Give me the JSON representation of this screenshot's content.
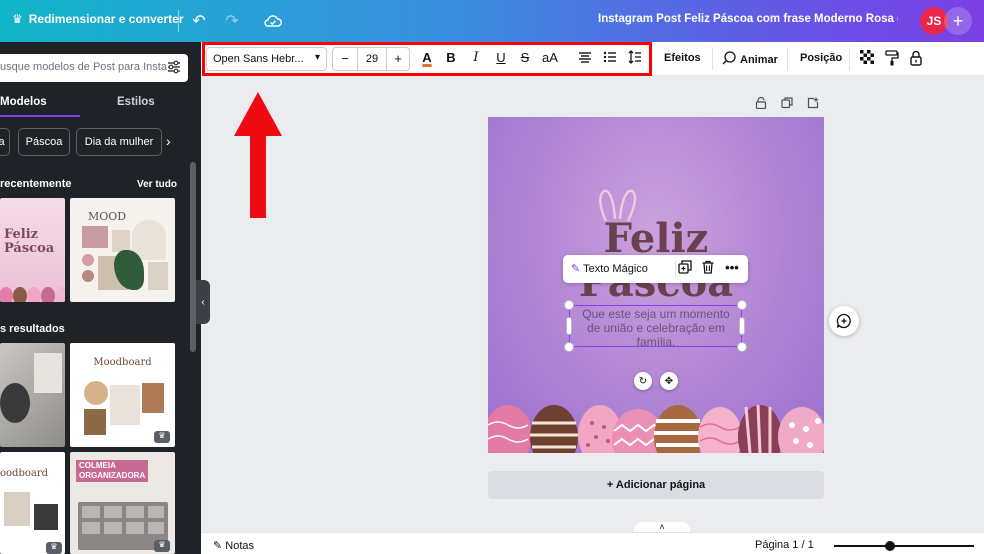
{
  "topbar": {
    "resize_label": "Redimensionar e converter",
    "design_title": "Instagram Post Feliz Páscoa com frase Moderno Rosa e Mar...",
    "avatar_initials": "JS",
    "add_label": "+"
  },
  "panel": {
    "search_placeholder": "usque modelos de Post para Insta",
    "tabs": [
      "Modelos",
      "Estilos"
    ],
    "chips": [
      "a",
      "Páscoa",
      "Dia da mulher"
    ],
    "recent_title": "recentemente",
    "recent_link": "Ver tudo",
    "results_title": "s resultados",
    "thumbs": {
      "t1_title": "Feliz\nPáscoa",
      "t2_title": "MOOD",
      "t3_title": "Moodboard",
      "t4_title": "oodboard",
      "t5_title": "COLMEIA\nORGANIZADORA"
    }
  },
  "toolbar": {
    "font": "Open Sans Hebr...",
    "size_minus": "−",
    "size_value": "29",
    "size_plus": "+",
    "text_color_glyph": "A",
    "bold": "B",
    "italic": "I",
    "underline": "U",
    "strike": "S",
    "case": "aA",
    "effects": "Efeitos",
    "animate": "Animar",
    "position": "Posição"
  },
  "design": {
    "title_line1": "Feliz",
    "title_line2": "Páscoa",
    "subtext": "Que este seja um momento de união e celebração em família."
  },
  "context_menu": {
    "magic_text": "Texto Mágico"
  },
  "canvas": {
    "add_page": "+ Adicionar página"
  },
  "bottombar": {
    "notes": "Notas",
    "page_indicator": "Página 1 / 1",
    "zoom_fraction": 0.4
  }
}
